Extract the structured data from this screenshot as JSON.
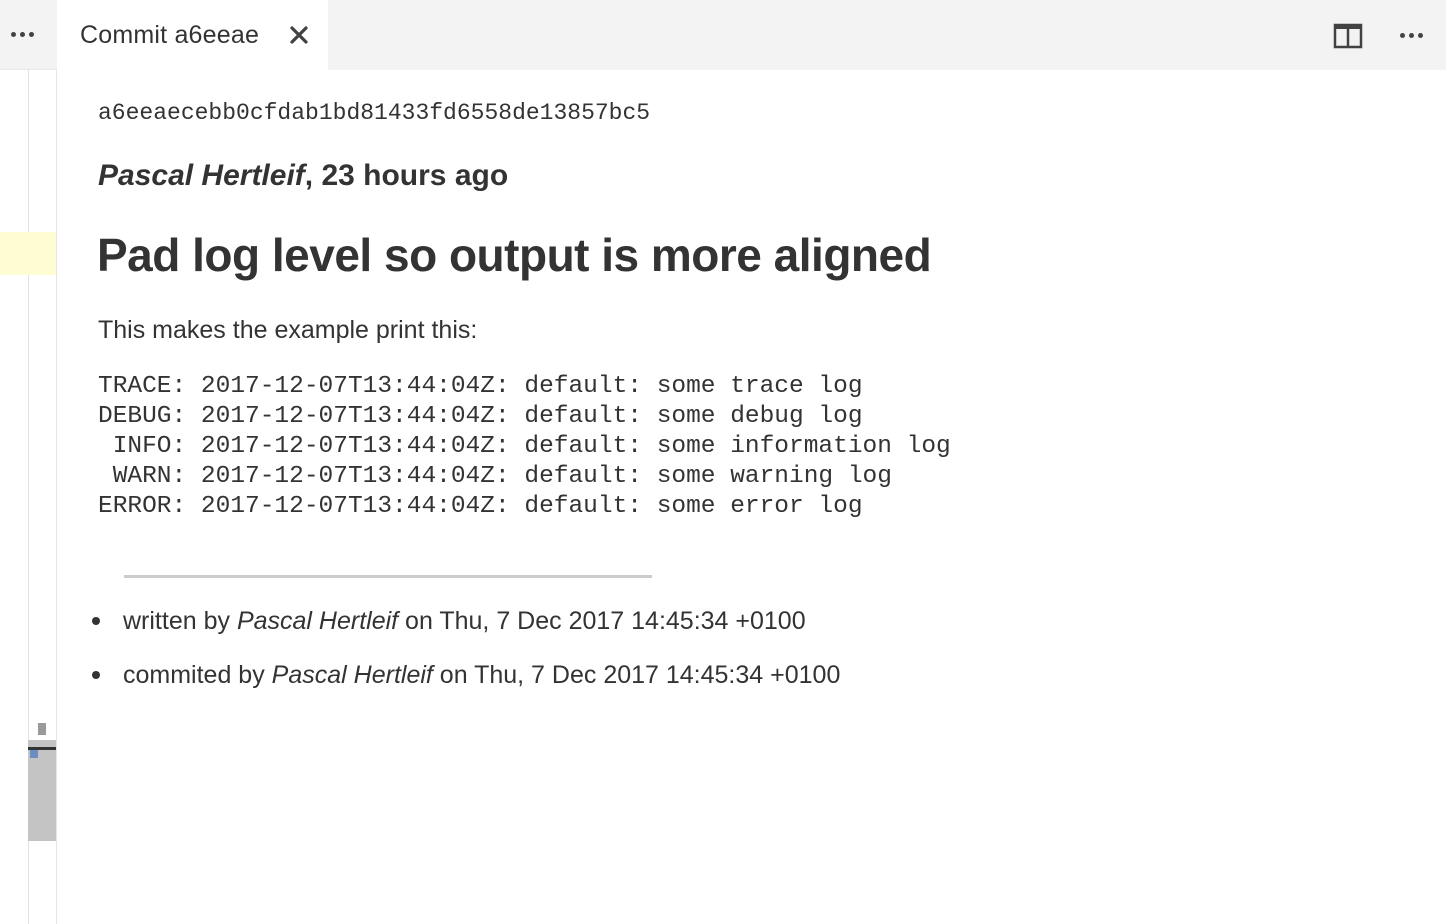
{
  "tab": {
    "title": "Commit a6eeae"
  },
  "commit": {
    "sha": "a6eeaecebb0cfdab1bd81433fd6558de13857bc5",
    "author": "Pascal Hertleif",
    "byline_separator": ", ",
    "relative_time": "23 hours ago",
    "title": "Pad log level so output is more aligned",
    "intro": "This makes the example print this:",
    "code_lines": [
      "TRACE: 2017-12-07T13:44:04Z: default: some trace log",
      "DEBUG: 2017-12-07T13:44:04Z: default: some debug log",
      " INFO: 2017-12-07T13:44:04Z: default: some information log",
      " WARN: 2017-12-07T13:44:04Z: default: some warning log",
      "ERROR: 2017-12-07T13:44:04Z: default: some error log"
    ],
    "meta": [
      {
        "prefix": "written by ",
        "person": "Pascal Hertleif",
        "suffix": " on Thu, 7 Dec 2017 14:45:34 +0100"
      },
      {
        "prefix": "commited by ",
        "person": "Pascal Hertleif",
        "suffix": " on Thu, 7 Dec 2017 14:45:34 +0100"
      }
    ]
  },
  "icons": {
    "left_more": "more-actions-icon",
    "tab_close": "close-icon",
    "split": "split-editor-icon",
    "right_more": "more-actions-icon"
  },
  "colors": {
    "text": "#333333",
    "tabbar_bg": "#f3f3f3",
    "highlight": "#fdfcd2",
    "rule": "#cccccc"
  }
}
